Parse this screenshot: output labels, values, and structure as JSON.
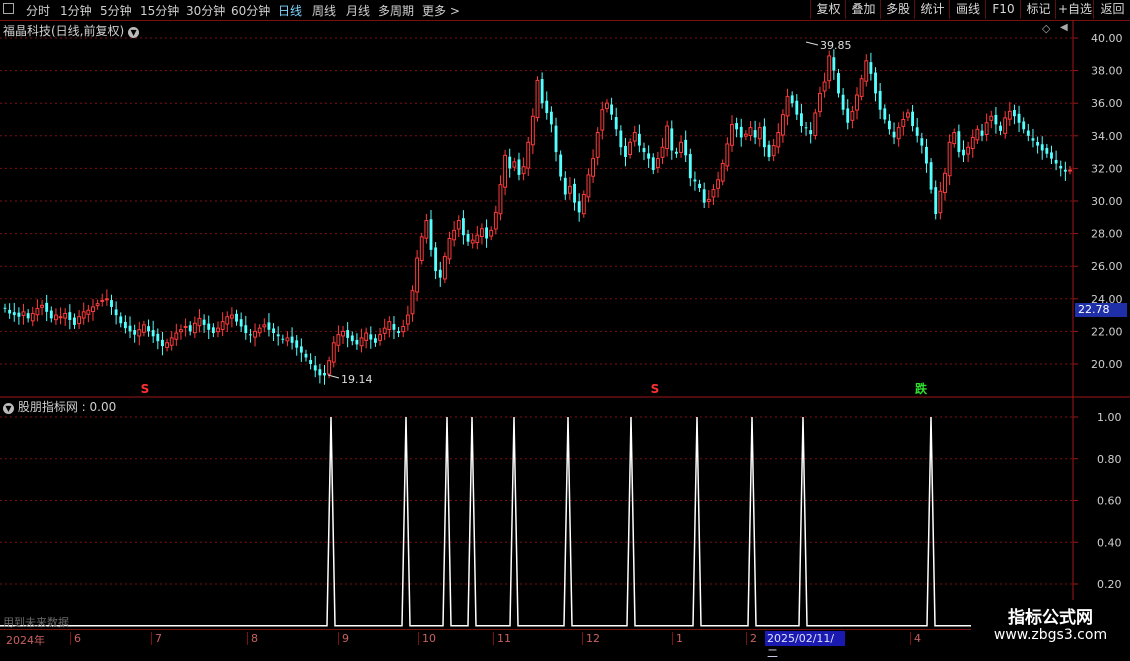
{
  "toolbar": {
    "periods": [
      "分时",
      "1分钟",
      "5分钟",
      "15分钟",
      "30分钟",
      "60分钟",
      "日线",
      "周线",
      "月线",
      "多周期",
      "更多 >"
    ],
    "active": "日线",
    "right_buttons": [
      "复权",
      "叠加",
      "多股",
      "统计",
      "画线",
      "F10",
      "标记",
      "+自选",
      "返回"
    ]
  },
  "main": {
    "title": "福晶科技(日线,前复权)",
    "price_axis": [
      "40.00",
      "38.00",
      "36.00",
      "34.00",
      "32.00",
      "30.00",
      "28.00",
      "26.00",
      "24.00",
      "22.00",
      "20.00"
    ],
    "current_price": "22.78",
    "high_label": "39.85",
    "low_label": "19.14",
    "signals": [
      {
        "text": "S",
        "color": "#ff3030"
      },
      {
        "text": "S",
        "color": "#ff3030"
      },
      {
        "text": "跌",
        "color": "#30e030"
      }
    ]
  },
  "indicator": {
    "title": "股朋指标网 : 0.00",
    "axis": [
      "1.00",
      "0.80",
      "0.60",
      "0.40",
      "0.20"
    ],
    "note": "用到未来数据"
  },
  "time_axis": {
    "labels": [
      "2024年",
      "6",
      "7",
      "8",
      "9",
      "10",
      "11",
      "12",
      "1",
      "2",
      "4"
    ],
    "cursor_date": "2025/02/11/二"
  },
  "watermark": {
    "line1": "指标公式网",
    "line2": "www.zbgs3.com"
  },
  "colors": {
    "up": "#ff3b3b",
    "down": "#54ffff",
    "grid": "#7a1111",
    "border": "#a01818"
  },
  "chart_data": {
    "type": "candlestick",
    "y_range": [
      18.5,
      40.6
    ],
    "closes": [
      23.4,
      23.1,
      23.0,
      22.9,
      23.2,
      22.8,
      23.1,
      23.4,
      23.6,
      23.2,
      22.8,
      23.0,
      22.9,
      23.1,
      22.7,
      22.4,
      22.9,
      23.2,
      23.3,
      23.5,
      23.7,
      23.9,
      24.0,
      23.5,
      23.0,
      22.5,
      22.2,
      22.0,
      21.8,
      22.1,
      22.4,
      22.0,
      21.7,
      21.4,
      21.1,
      21.3,
      21.6,
      21.9,
      22.1,
      22.3,
      22.0,
      22.5,
      22.8,
      22.4,
      22.1,
      21.9,
      22.2,
      22.6,
      22.9,
      23.0,
      22.6,
      22.3,
      21.9,
      21.8,
      22.0,
      22.2,
      22.4,
      22.1,
      21.9,
      21.7,
      21.5,
      21.6,
      21.3,
      21.0,
      20.7,
      20.4,
      20.0,
      19.6,
      19.3,
      19.3,
      20.2,
      21.3,
      21.8,
      22.0,
      21.6,
      21.4,
      21.2,
      21.6,
      21.9,
      21.5,
      21.3,
      21.8,
      22.2,
      22.6,
      22.1,
      21.9,
      22.3,
      23.0,
      24.5,
      26.5,
      27.8,
      28.8,
      27.0,
      25.7,
      25.3,
      26.6,
      27.7,
      28.2,
      28.8,
      27.9,
      27.5,
      27.6,
      27.9,
      28.3,
      27.7,
      28.2,
      29.3,
      31.0,
      32.8,
      32.0,
      32.4,
      31.6,
      32.1,
      33.6,
      35.2,
      37.4,
      36.0,
      35.4,
      34.7,
      33.0,
      31.5,
      30.4,
      30.9,
      29.9,
      29.3,
      30.4,
      31.6,
      32.6,
      34.2,
      35.6,
      36.0,
      35.3,
      34.4,
      33.3,
      32.7,
      33.6,
      34.2,
      33.4,
      33.0,
      32.6,
      31.9,
      32.6,
      33.3,
      34.6,
      33.1,
      32.9,
      33.6,
      32.8,
      31.4,
      31.2,
      30.8,
      29.9,
      30.1,
      30.7,
      31.3,
      32.3,
      33.5,
      34.7,
      34.4,
      33.9,
      34.1,
      34.5,
      33.9,
      34.5,
      33.3,
      32.7,
      33.4,
      34.2,
      35.3,
      36.4,
      36.0,
      35.3,
      34.6,
      34.5,
      34.1,
      35.4,
      36.6,
      37.3,
      38.9,
      38.0,
      36.6,
      35.6,
      34.8,
      35.5,
      36.5,
      37.5,
      38.6,
      37.8,
      36.6,
      35.6,
      35.0,
      34.4,
      33.9,
      34.5,
      35.0,
      35.4,
      34.6,
      34.0,
      33.4,
      32.3,
      30.7,
      29.2,
      30.6,
      31.7,
      33.6,
      34.2,
      33.0,
      32.8,
      33.3,
      33.9,
      34.4,
      34.0,
      34.8,
      35.2,
      34.7,
      34.3,
      35.1,
      35.5,
      35.2,
      34.8,
      34.4,
      34.0,
      33.7,
      33.4,
      33.1,
      32.9,
      32.6,
      32.3,
      32.0,
      31.8,
      31.9
    ]
  }
}
